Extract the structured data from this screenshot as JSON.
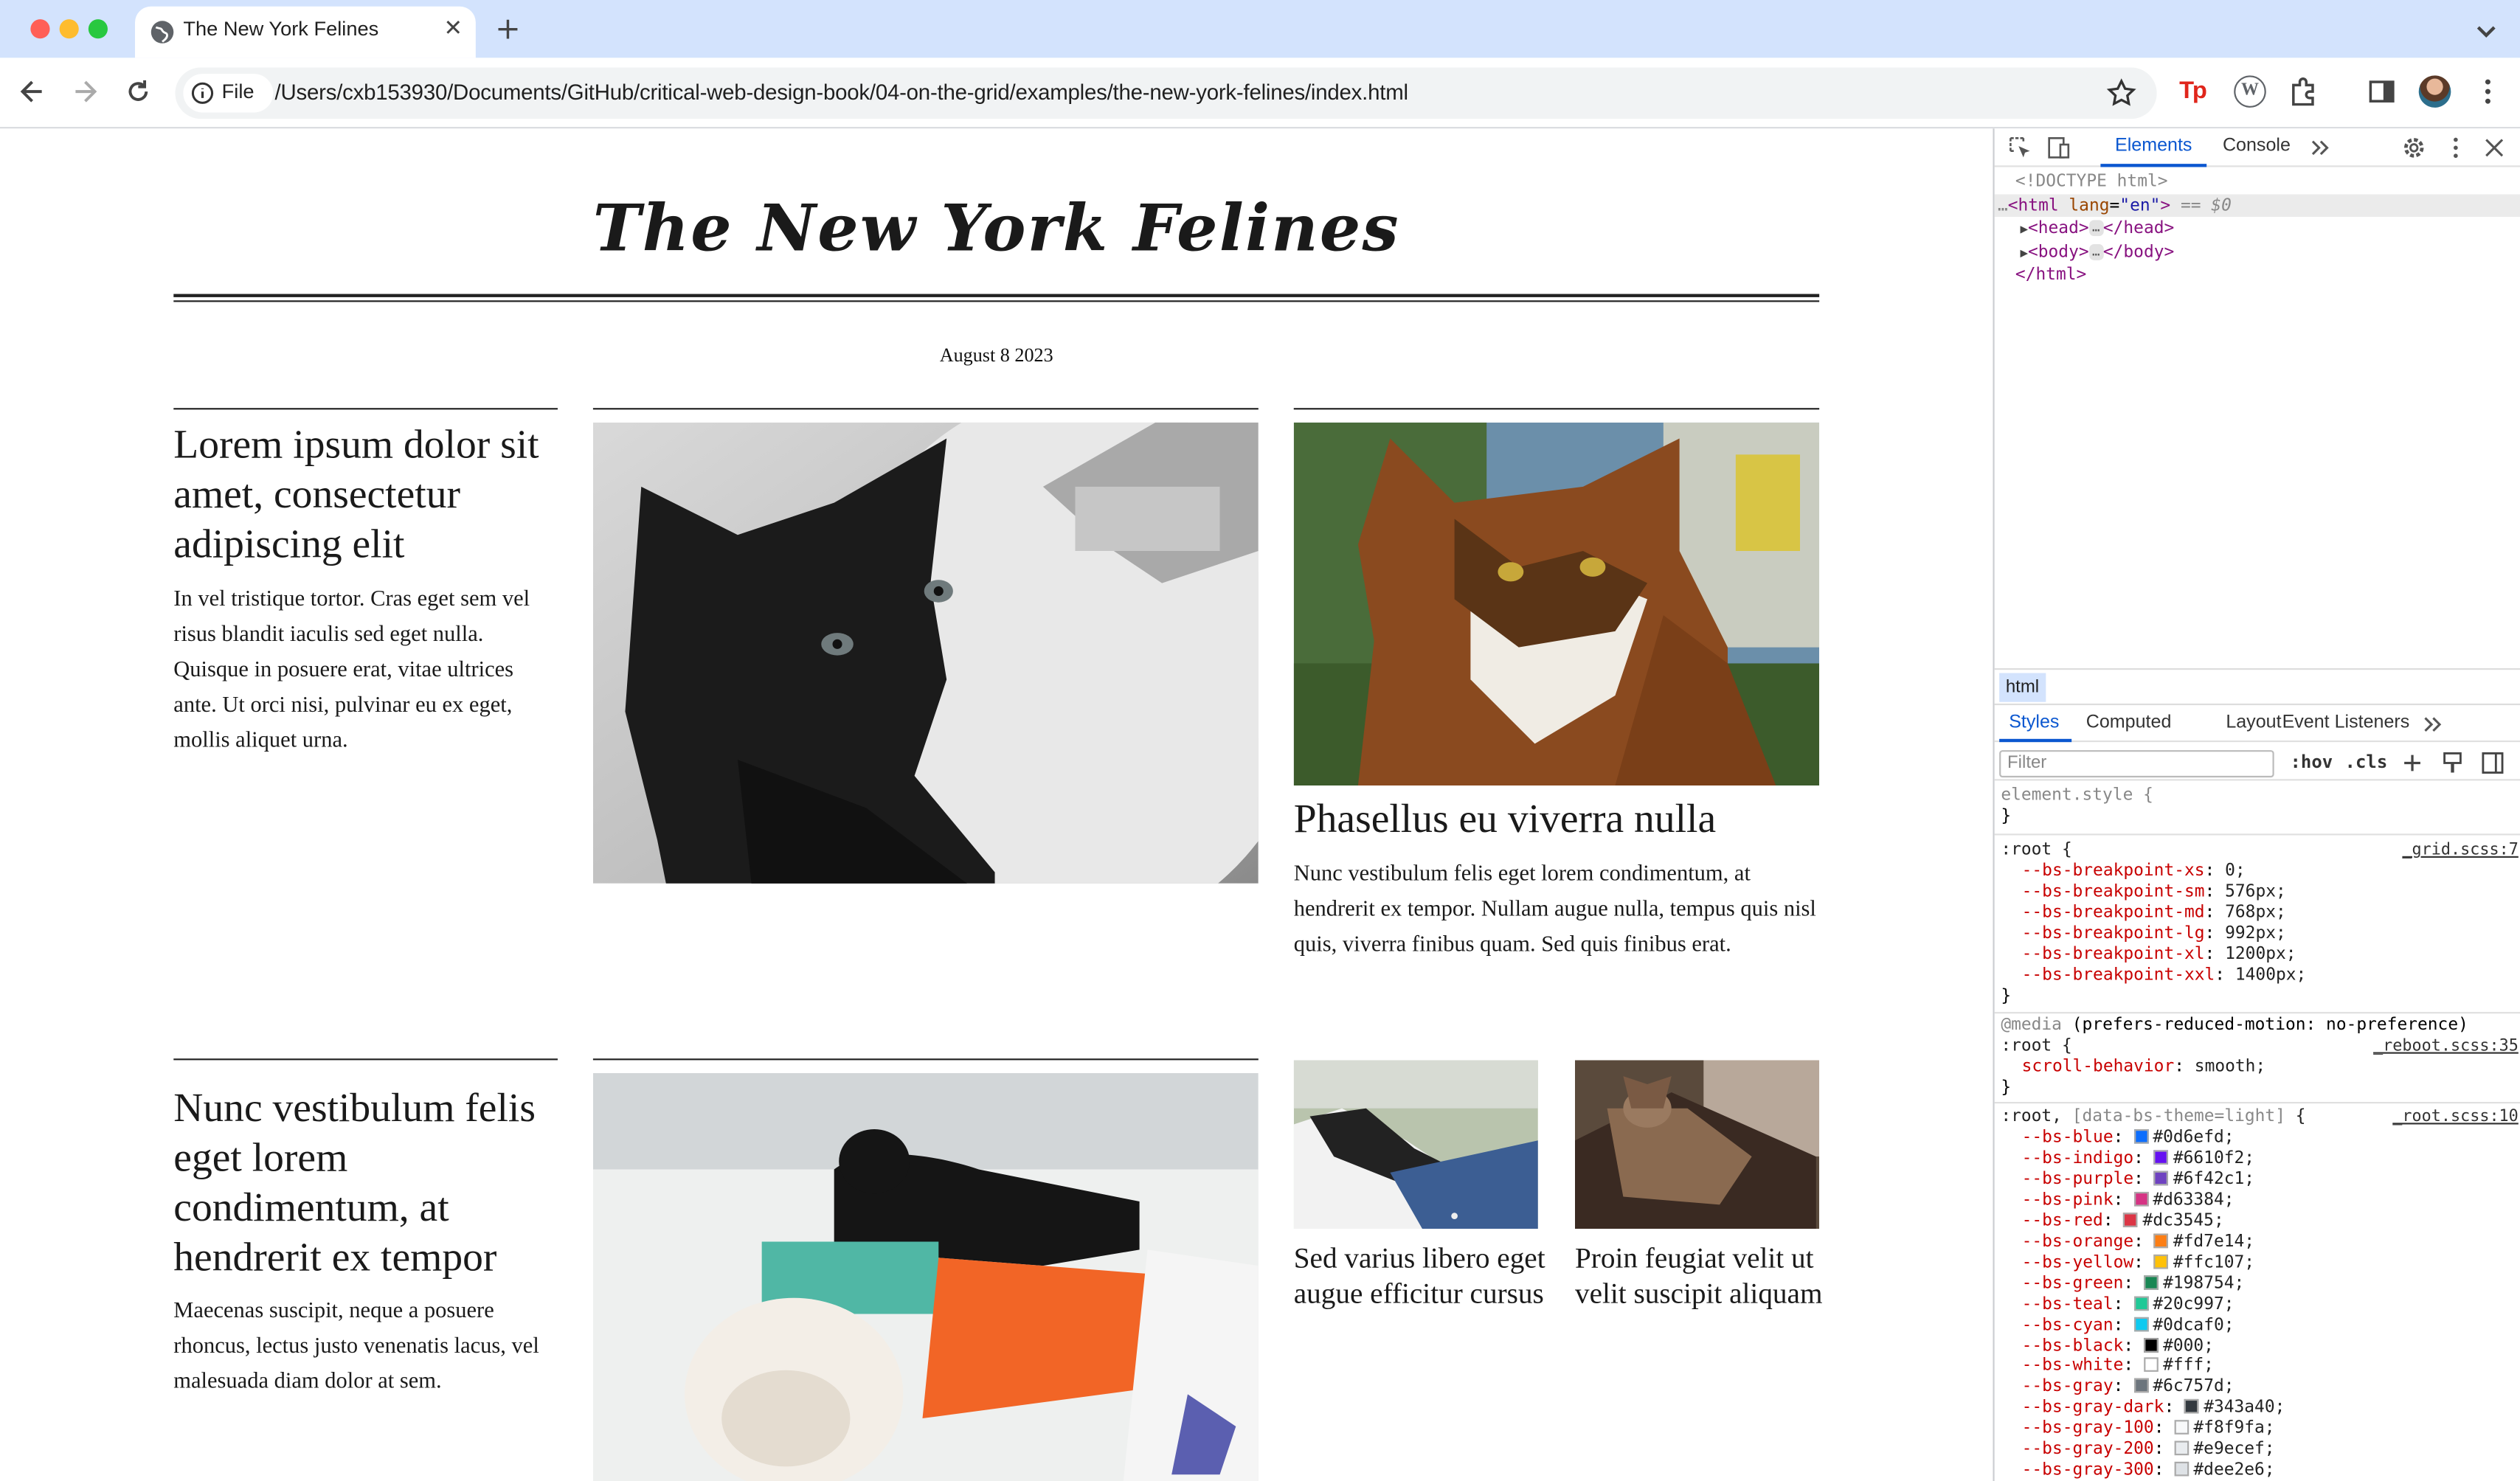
{
  "browser": {
    "tab_title": "The New York Felines",
    "chip_label": "File",
    "url": "/Users/cxb153930/Documents/GitHub/critical-web-design-book/04-on-the-grid/examples/the-new-york-felines/index.html",
    "tp_label": "Tp",
    "wp_label": "W"
  },
  "page": {
    "masthead": "The New York Felines",
    "date": "August 8 2023",
    "articles": [
      {
        "headline": "Lorem ipsum dolor sit amet, consectetur adipiscing elit",
        "body": "In vel tristique tortor. Cras eget sem vel risus blandit iaculis sed eget nulla. Quisque in posuere erat, vitae ultrices ante. Ut orci nisi, pulvinar eu ex eget, mollis aliquet urna."
      },
      {
        "headline": "Phasellus eu viverra nulla",
        "body": "Nunc vestibulum felis eget lorem condimentum, at hendrerit ex tempor. Nullam augue nulla, tempus quis nisl quis, viverra finibus quam. Sed quis finibus erat."
      },
      {
        "headline": "Nunc vestibulum felis eget lorem condimentum, at hendrerit ex tempor",
        "body": "Maecenas suscipit, neque a posuere rhoncus, lectus justo venenatis lacus, vel malesuada diam dolor at sem."
      },
      {
        "headline": "Sed varius libero eget augue efficitur cursus"
      },
      {
        "headline": "Proin feugiat velit ut velit suscipit aliquam"
      }
    ]
  },
  "devtools": {
    "tabs": [
      "Elements",
      "Console"
    ],
    "dom": {
      "doctype": "<!DOCTYPE html>",
      "html_open": "<html",
      "lang_attr": "lang",
      "lang_val": "\"en\"",
      "html_close_bracket": ">",
      "selected_marker": "== $0",
      "head_open": "<head>",
      "head_close": "</head>",
      "body_open": "<body>",
      "body_close": "</body>",
      "html_end": "</html>",
      "ellipsis": "…"
    },
    "breadcrumb": "html",
    "subtabs": [
      "Styles",
      "Computed",
      "Layout",
      "Event Listeners"
    ],
    "filter_placeholder": "Filter",
    "hov": ":hov",
    "cls": ".cls",
    "styles": {
      "element_style": "element.style {",
      "close_brace": "}",
      "root_sel": ":root {",
      "grid_src": "_grid.scss:7",
      "breakpoints": [
        {
          "prop": "--bs-breakpoint-xs",
          "val": "0;"
        },
        {
          "prop": "--bs-breakpoint-sm",
          "val": "576px;"
        },
        {
          "prop": "--bs-breakpoint-md",
          "val": "768px;"
        },
        {
          "prop": "--bs-breakpoint-lg",
          "val": "992px;"
        },
        {
          "prop": "--bs-breakpoint-xl",
          "val": "1200px;"
        },
        {
          "prop": "--bs-breakpoint-xxl",
          "val": "1400px;"
        }
      ],
      "media_kw": "@media",
      "media_query": "(prefers-reduced-motion: no-preference)",
      "reboot_src": "_reboot.scss:35",
      "scroll_prop": "scroll-behavior",
      "scroll_val": "smooth;",
      "theme_sel_a": ":root,",
      "theme_sel_b": "[data-bs-theme=light]",
      "theme_sel_c": "{",
      "root_src": "_root.scss:10",
      "colors": [
        {
          "prop": "--bs-blue",
          "val": "#0d6efd;",
          "swatch": "#0d6efd"
        },
        {
          "prop": "--bs-indigo",
          "val": "#6610f2;",
          "swatch": "#6610f2"
        },
        {
          "prop": "--bs-purple",
          "val": "#6f42c1;",
          "swatch": "#6f42c1"
        },
        {
          "prop": "--bs-pink",
          "val": "#d63384;",
          "swatch": "#d63384"
        },
        {
          "prop": "--bs-red",
          "val": "#dc3545;",
          "swatch": "#dc3545"
        },
        {
          "prop": "--bs-orange",
          "val": "#fd7e14;",
          "swatch": "#fd7e14"
        },
        {
          "prop": "--bs-yellow",
          "val": "#ffc107;",
          "swatch": "#ffc107"
        },
        {
          "prop": "--bs-green",
          "val": "#198754;",
          "swatch": "#198754"
        },
        {
          "prop": "--bs-teal",
          "val": "#20c997;",
          "swatch": "#20c997"
        },
        {
          "prop": "--bs-cyan",
          "val": "#0dcaf0;",
          "swatch": "#0dcaf0"
        },
        {
          "prop": "--bs-black",
          "val": "#000;",
          "swatch": "#000000"
        },
        {
          "prop": "--bs-white",
          "val": "#fff;",
          "swatch": "#ffffff"
        },
        {
          "prop": "--bs-gray",
          "val": "#6c757d;",
          "swatch": "#6c757d"
        },
        {
          "prop": "--bs-gray-dark",
          "val": "#343a40;",
          "swatch": "#343a40"
        },
        {
          "prop": "--bs-gray-100",
          "val": "#f8f9fa;",
          "swatch": "#f8f9fa"
        },
        {
          "prop": "--bs-gray-200",
          "val": "#e9ecef;",
          "swatch": "#e9ecef"
        },
        {
          "prop": "--bs-gray-300",
          "val": "#dee2e6;",
          "swatch": "#dee2e6"
        }
      ]
    }
  }
}
